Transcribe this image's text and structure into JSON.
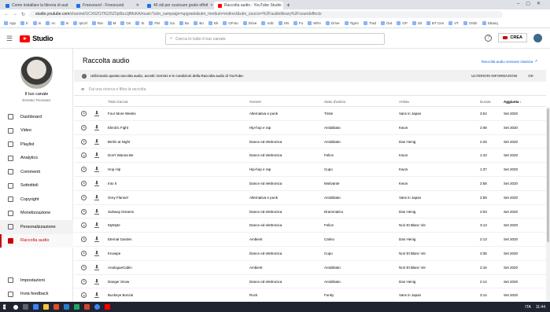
{
  "browser": {
    "tabs": [
      {
        "title": "Come installare la libreria di aud",
        "active": false
      },
      {
        "title": "Freesound - Freesound",
        "active": false
      },
      {
        "title": "40 siti per scaricare gratis effett",
        "active": false
      },
      {
        "title": "Raccolta audio - YouTube Studio",
        "active": true
      }
    ],
    "new_tab": "+",
    "url_host": "studio.youtube.com",
    "url_path": "/channel/UCX6ZGTfG25Z2p0bu1jfMsKA/music?utm_campaign=upgrade&utm_medium=redirect&utm_source=%2Faudiolibrary%2Fsoundeffects",
    "bookmarks": [
      "App",
      "b",
      "In",
      "Ac",
      "In",
      "IpCel",
      "Rai",
      "M",
      "On",
      "Si",
      "FM",
      "Ga",
      "Bo",
      "Bo",
      "Ek",
      "GFoto",
      "Drive",
      "AdS",
      "SN",
      "Fo",
      "WhA",
      "Drive",
      "Tigrm",
      "Trad",
      "Out",
      "GP",
      "Sit",
      "BT Cen",
      "VT",
      "OnDr",
      "Sbanq"
    ]
  },
  "header": {
    "logo_text": "Studio",
    "search_placeholder": "Cerca in tutto il tuo canale",
    "help": "?",
    "create_label": "CREA"
  },
  "sidebar": {
    "channel_label": "Il tuo canale",
    "channel_name": "Ernesto Trionsanz",
    "items": [
      {
        "label": "Dashboard",
        "icon": "dashboard-icon"
      },
      {
        "label": "Video",
        "icon": "video-icon"
      },
      {
        "label": "Playlist",
        "icon": "playlist-icon"
      },
      {
        "label": "Analytics",
        "icon": "analytics-icon"
      },
      {
        "label": "Commenti",
        "icon": "comments-icon"
      },
      {
        "label": "Sottotitoli",
        "icon": "subtitles-icon"
      },
      {
        "label": "Copyright",
        "icon": "copyright-icon"
      },
      {
        "label": "Monetizzazione",
        "icon": "dollar-icon"
      },
      {
        "label": "Personalizzazione",
        "icon": "wand-icon"
      },
      {
        "label": "Raccolta audio",
        "icon": "audio-library-icon"
      }
    ],
    "bottom_items": [
      {
        "label": "Impostazioni",
        "icon": "gear-icon"
      },
      {
        "label": "Invia feedback",
        "icon": "feedback-icon"
      }
    ]
  },
  "main": {
    "title": "Raccolta audio",
    "classic_link": "Raccolta audio versione classica",
    "banner": {
      "text": "Utilizzando questa raccolta audio, accetti i termini e le condizioni della Raccolta audio di YouTube.",
      "more_info": "ULTERIORI INFORMAZIONI",
      "ok": "OK"
    },
    "filter_placeholder": "Fai una ricerca o filtra la raccolta",
    "columns": {
      "title": "Titolo traccia",
      "genre": "Genere",
      "mood": "Stato d'animo",
      "artist": "Artista",
      "duration": "Durata",
      "added": "Aggiunta"
    },
    "tracks": [
      {
        "title": "Four More Weeks",
        "genre": "Alternativa e punk",
        "mood": "Triste",
        "artist": "Vans in Japan",
        "duration": "3:04",
        "added": "Set 2020"
      },
      {
        "title": "Electric Fight",
        "genre": "Hip-hop e rap",
        "mood": "Arrabbiato",
        "artist": "Kwon",
        "duration": "2:08",
        "added": "Set 2020"
      },
      {
        "title": "Berlin at Night",
        "genre": "Dance ed elettronica",
        "mood": "Arrabbiato",
        "artist": "Dan Henig",
        "duration": "2:25",
        "added": "Set 2020"
      },
      {
        "title": "Don't Wanna Be",
        "genre": "Dance ed elettronica",
        "mood": "Felice",
        "artist": "Kwon",
        "duration": "1:43",
        "added": "Set 2020"
      },
      {
        "title": "Hop Hip",
        "genre": "Hip-hop e rap",
        "mood": "Cupo",
        "artist": "Kwon",
        "duration": "1:37",
        "added": "Set 2020"
      },
      {
        "title": "Into It",
        "genre": "Dance ed elettronica",
        "mood": "Motivante",
        "artist": "Kwon",
        "duration": "2:58",
        "added": "Set 2020"
      },
      {
        "title": "Grey Flannel",
        "genre": "Alternativa e punk",
        "mood": "Arrabbiato",
        "artist": "Vans in Japan",
        "duration": "2:59",
        "added": "Set 2020"
      },
      {
        "title": "Subway Dreams",
        "genre": "Dance ed elettronica",
        "mood": "Drammatico",
        "artist": "Dan Henig",
        "duration": "2:03",
        "added": "Set 2020"
      },
      {
        "title": "MyMyte",
        "genre": "Dance ed elettronica",
        "mood": "Felice",
        "artist": "Noir Et Blanc Vie",
        "duration": "3:13",
        "added": "Set 2020"
      },
      {
        "title": "Eternal Garden",
        "genre": "Ambient",
        "mood": "Calmo",
        "artist": "Dan Henig",
        "duration": "2:13",
        "added": "Set 2020"
      },
      {
        "title": "Knowpe",
        "genre": "Dance ed elettronica",
        "mood": "Cupo",
        "artist": "Noir Et Blanc Vie",
        "duration": "3:35",
        "added": "Set 2020"
      },
      {
        "title": "AnalogueCabin",
        "genre": "Ambient",
        "mood": "Arrabbiato",
        "artist": "Noir Et Blanc Vie",
        "duration": "2:16",
        "added": "Set 2020"
      },
      {
        "title": "Danger Snow",
        "genre": "Dance ed elettronica",
        "mood": "Arrabbiato",
        "artist": "Dan Henig",
        "duration": "2:14",
        "added": "Set 2020"
      },
      {
        "title": "Buckeye Bonzai",
        "genre": "Rock",
        "mood": "Funky",
        "artist": "Vans in Japan",
        "duration": "3:14",
        "added": "Set 2020"
      }
    ]
  },
  "taskbar": {
    "lang": "ITA",
    "time": "11:44"
  },
  "colors": {
    "accent": "#cc0000",
    "link": "#065fd4",
    "banner_bg": "#f1f1f1"
  }
}
